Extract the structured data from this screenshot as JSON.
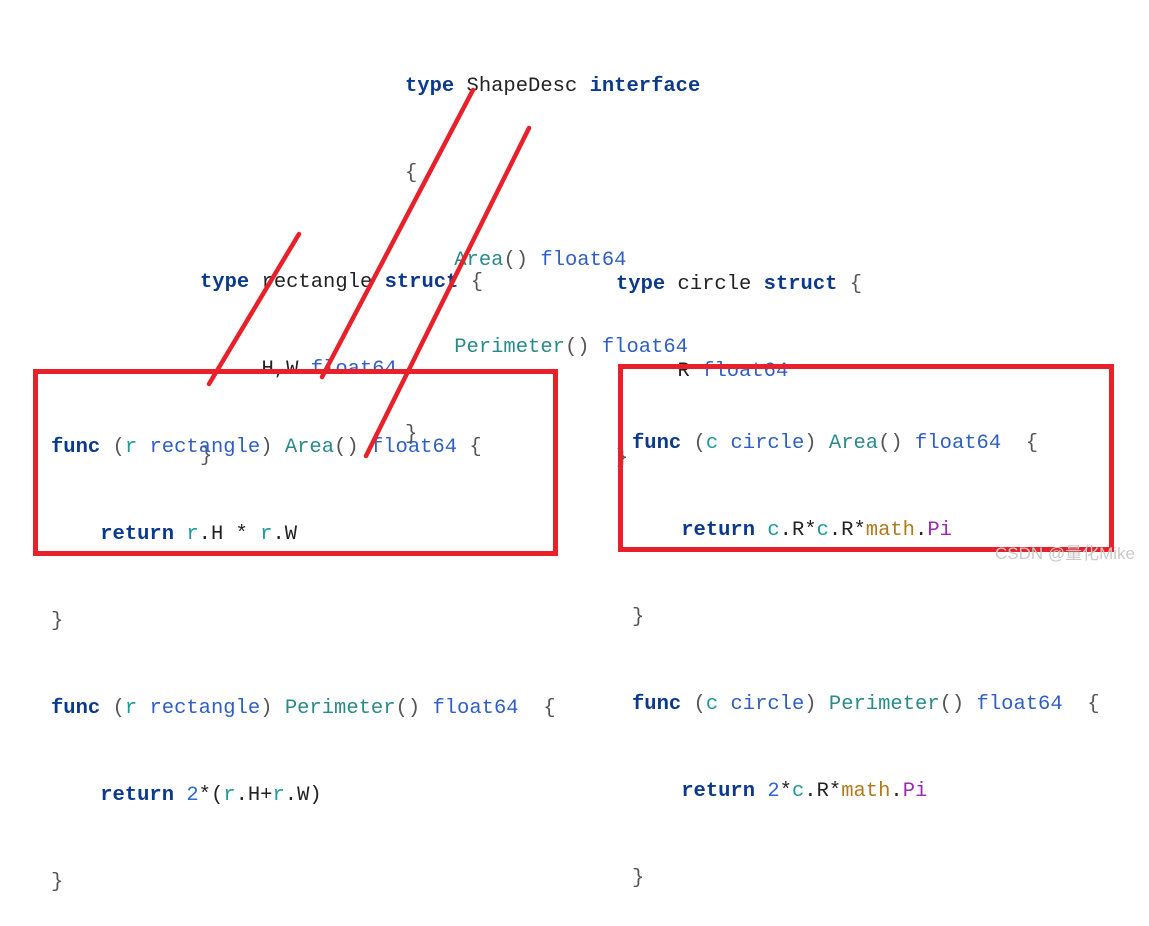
{
  "interface_block": {
    "keyword_type": "type",
    "name": "ShapeDesc",
    "keyword_interface": "interface",
    "open_brace": "{",
    "methods": [
      {
        "name": "Area",
        "parens": "()",
        "return_type": "float64"
      },
      {
        "name": "Perimeter",
        "parens": "()",
        "return_type": "float64"
      }
    ],
    "close_brace": "}"
  },
  "rectangle_struct": {
    "keyword_type": "type",
    "name": "rectangle",
    "keyword_struct": "struct",
    "open_brace": "{",
    "field_names": "H,W",
    "field_type": "float64",
    "close_brace": "}"
  },
  "circle_struct": {
    "keyword_type": "type",
    "name": "circle",
    "keyword_struct": "struct",
    "open_brace": "{",
    "field_names": "R",
    "field_type": "float64",
    "close_brace": "}"
  },
  "rectangle_methods": {
    "area": {
      "kw_func": "func",
      "open_paren": "(",
      "receiver": "r",
      "receiver_type": "rectangle",
      "close_paren": ")",
      "name": "Area",
      "parens": "()",
      "return_type": "float64",
      "open_brace": "{",
      "kw_return": "return",
      "expr": [
        {
          "t": "r",
          "c": "rc"
        },
        {
          "t": ".H * ",
          "c": "pl"
        },
        {
          "t": "r",
          "c": "rc"
        },
        {
          "t": ".W",
          "c": "pl"
        }
      ],
      "close_brace": "}"
    },
    "perimeter": {
      "kw_func": "func",
      "open_paren": "(",
      "receiver": "r",
      "receiver_type": "rectangle",
      "close_paren": ")",
      "name": "Perimeter",
      "parens": "()",
      "return_type": "float64",
      "open_brace": "{",
      "kw_return": "return",
      "expr": [
        {
          "t": "2",
          "c": "num"
        },
        {
          "t": "*(",
          "c": "pl"
        },
        {
          "t": "r",
          "c": "rc"
        },
        {
          "t": ".H+",
          "c": "pl"
        },
        {
          "t": "r",
          "c": "rc"
        },
        {
          "t": ".W)",
          "c": "pl"
        }
      ],
      "close_brace": "}"
    }
  },
  "circle_methods": {
    "area": {
      "kw_func": "func",
      "open_paren": "(",
      "receiver": "c",
      "receiver_type": "circle",
      "close_paren": ")",
      "name": "Area",
      "parens": "()",
      "return_type": "float64",
      "open_brace": "{",
      "kw_return": "return",
      "expr": [
        {
          "t": "c",
          "c": "rc"
        },
        {
          "t": ".R*",
          "c": "pl"
        },
        {
          "t": "c",
          "c": "rc"
        },
        {
          "t": ".R*",
          "c": "pl"
        },
        {
          "t": "math",
          "c": "pk"
        },
        {
          "t": ".",
          "c": "pl"
        },
        {
          "t": "Pi",
          "c": "mb"
        }
      ],
      "close_brace": "}"
    },
    "perimeter": {
      "kw_func": "func",
      "open_paren": "(",
      "receiver": "c",
      "receiver_type": "circle",
      "close_paren": ")",
      "name": "Perimeter",
      "parens": "()",
      "return_type": "float64",
      "open_brace": "{",
      "kw_return": "return",
      "expr": [
        {
          "t": "2",
          "c": "num"
        },
        {
          "t": "*",
          "c": "pl"
        },
        {
          "t": "c",
          "c": "rc"
        },
        {
          "t": ".R*",
          "c": "pl"
        },
        {
          "t": "math",
          "c": "pk"
        },
        {
          "t": ".",
          "c": "pl"
        },
        {
          "t": "Pi",
          "c": "mb"
        }
      ],
      "close_brace": "}"
    }
  },
  "annotation": {
    "highlight_color": "#e8202a",
    "connectors": [
      {
        "from": "interface-method-area",
        "to": "rectangle-area-method"
      },
      {
        "from": "interface-method-perimeter",
        "to": "rectangle-perimeter-method"
      },
      {
        "from": "rectangle-struct",
        "to": "rectangle-receiver"
      }
    ]
  },
  "watermark": "CSDN @量化Mike"
}
